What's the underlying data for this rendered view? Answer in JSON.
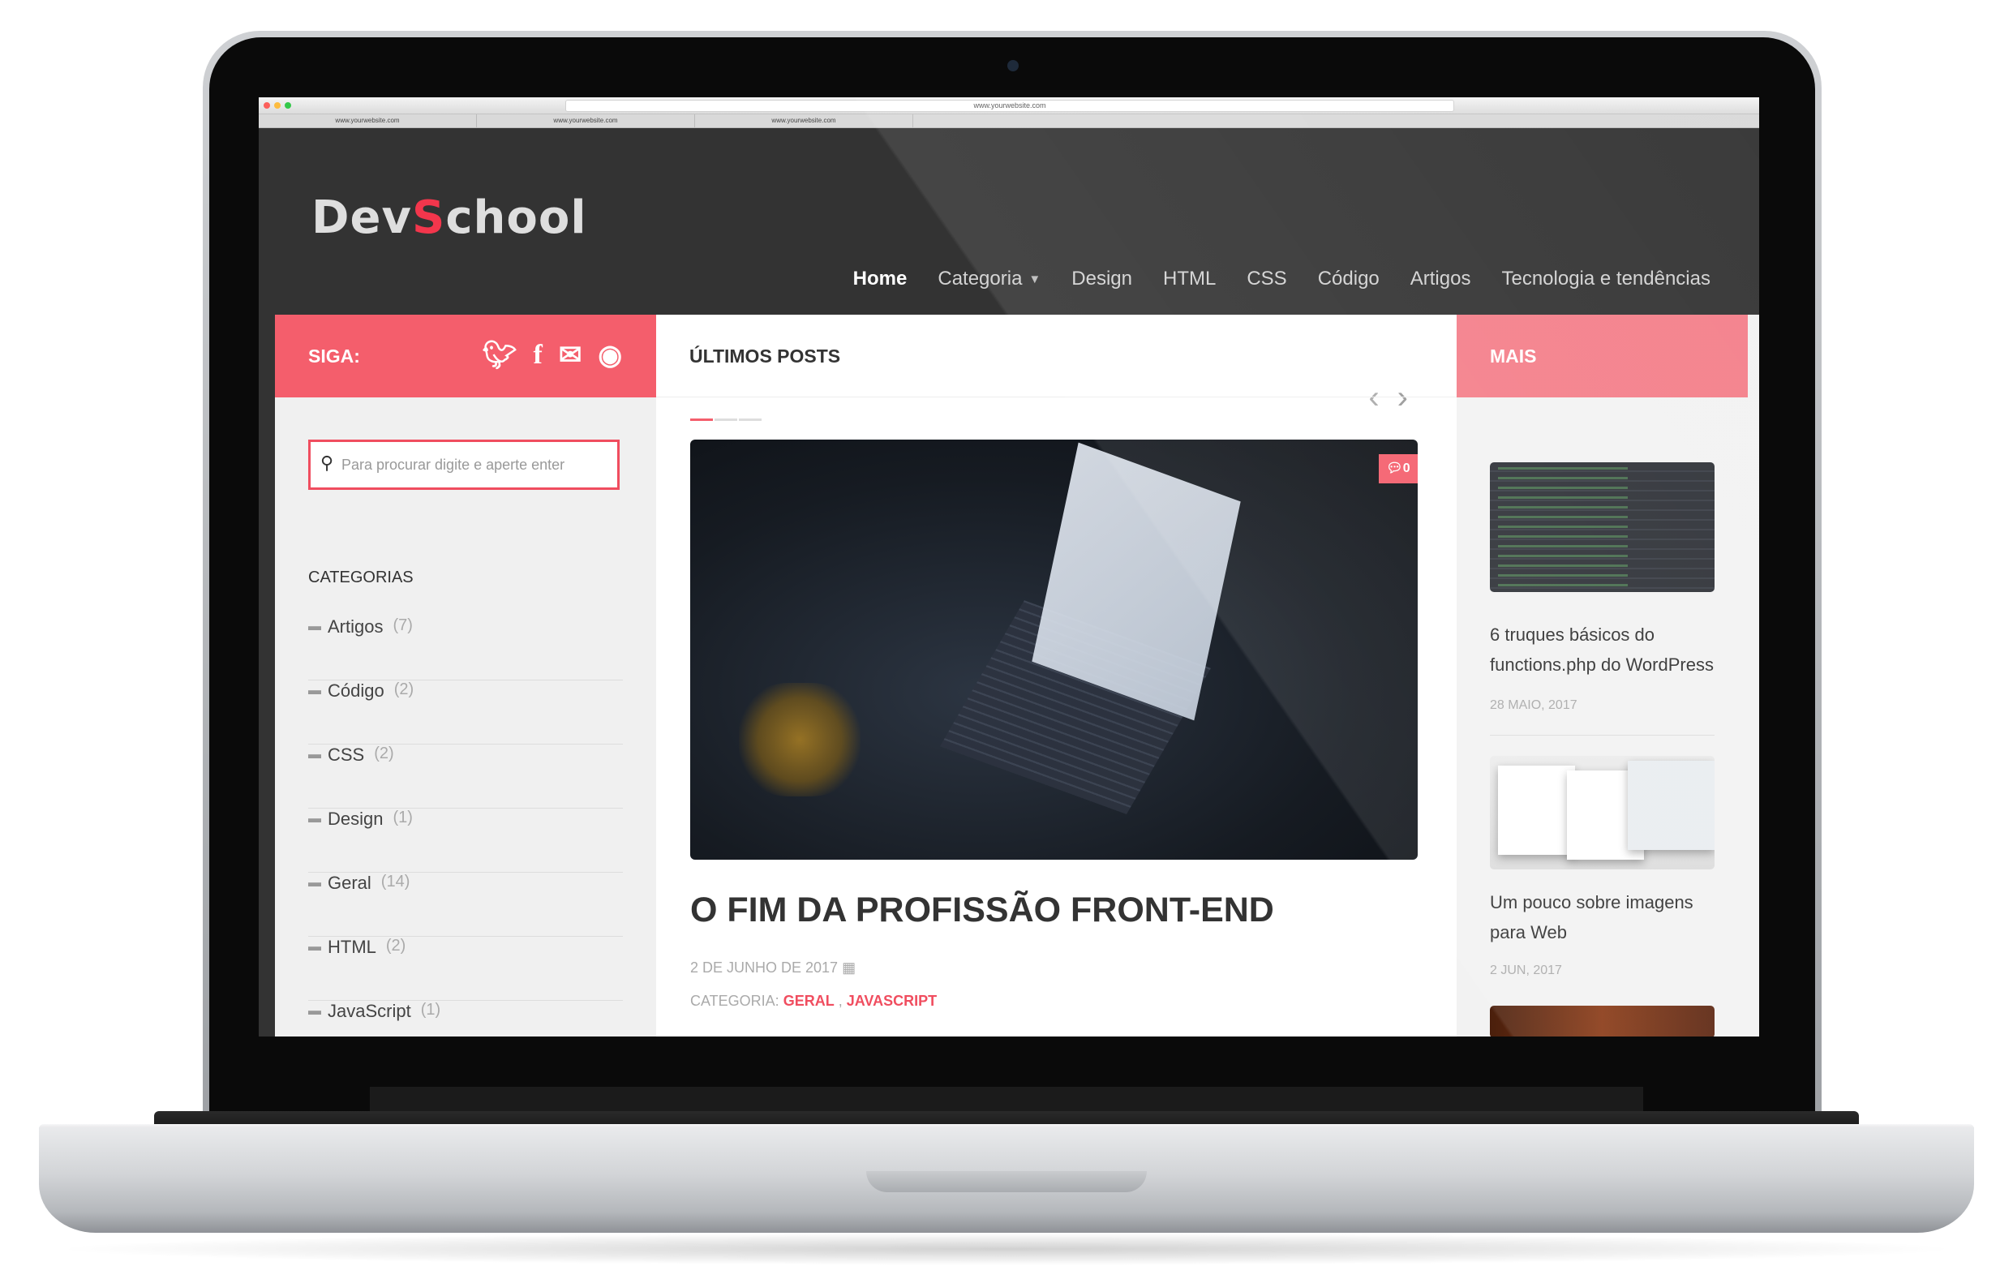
{
  "browser": {
    "address": "www.yourwebsite.com",
    "tabs": [
      "www.yourwebsite.com",
      "www.yourwebsite.com",
      "www.yourwebsite.com"
    ]
  },
  "site": {
    "logo_prefix": "Dev",
    "logo_accent": "S",
    "logo_suffix": "chool",
    "nav": [
      "Home",
      "Categoria",
      "Design",
      "HTML",
      "CSS",
      "Código",
      "Artigos",
      "Tecnologia e tendências"
    ]
  },
  "left": {
    "follow_label": "SIGA:",
    "social_icons": [
      "twitter-icon",
      "facebook-icon",
      "envelope-icon",
      "github-icon"
    ],
    "search_placeholder": "Para procurar digite e aperte enter",
    "categories_title": "CATEGORIAS",
    "categories": [
      {
        "name": "Artigos",
        "count": "(7)"
      },
      {
        "name": "Código",
        "count": "(2)"
      },
      {
        "name": "CSS",
        "count": "(2)"
      },
      {
        "name": "Design",
        "count": "(1)"
      },
      {
        "name": "Geral",
        "count": "(14)"
      },
      {
        "name": "HTML",
        "count": "(2)"
      },
      {
        "name": "JavaScript",
        "count": "(1)"
      }
    ]
  },
  "center": {
    "section_title": "ÚLTIMOS POSTS",
    "comment_count": "0",
    "post_title": "O FIM DA PROFISSÃO FRONT-END",
    "post_date": "2 DE JUNHO DE 2017",
    "category_label": "CATEGORIA:",
    "category_links": [
      "GERAL",
      "JAVASCRIPT"
    ],
    "category_separator": ","
  },
  "right": {
    "section_title": "MAIS",
    "posts": [
      {
        "title": "6 truques básicos do functions.php do WordPress",
        "date": "28 MAIO, 2017"
      },
      {
        "title": "Um pouco sobre imagens para Web",
        "date": "2 JUN, 2017"
      }
    ]
  },
  "colors": {
    "accent": "#f45e6c",
    "header_bg": "#333333",
    "right_accent": "#f47f8a"
  }
}
